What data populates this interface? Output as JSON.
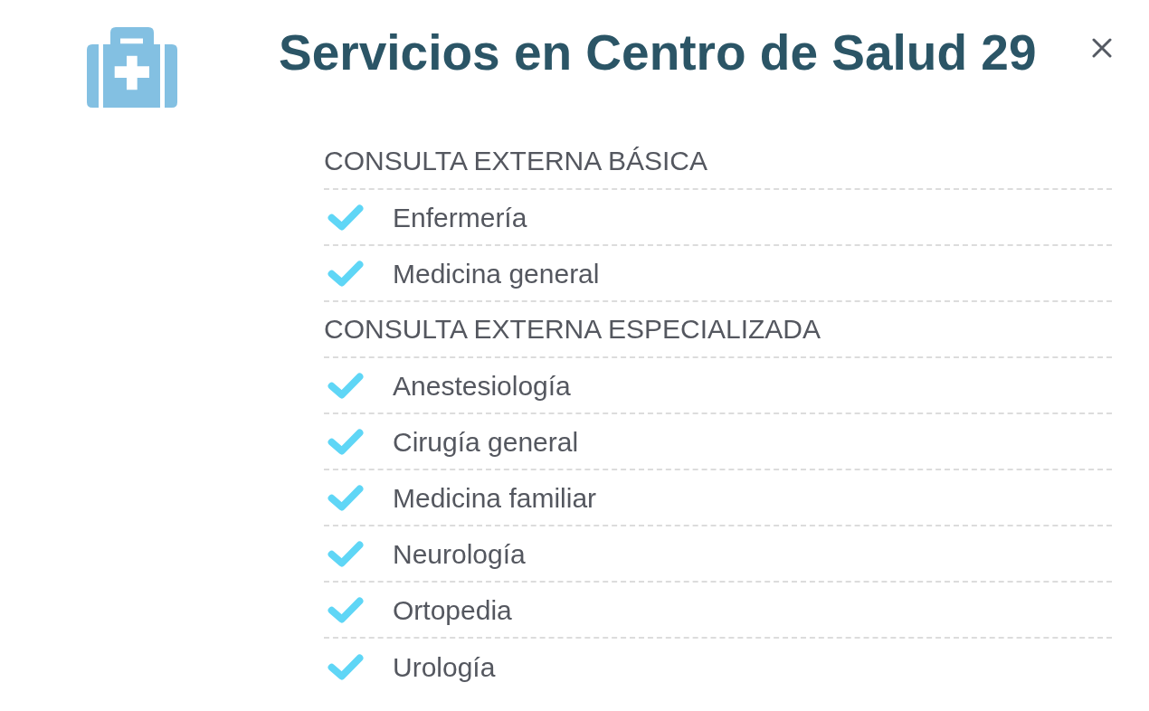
{
  "header": {
    "title": "Servicios en Centro de Salud 29"
  },
  "sections": [
    {
      "heading": "CONSULTA EXTERNA BÁSICA",
      "items": [
        "Enfermería",
        "Medicina general"
      ]
    },
    {
      "heading": "CONSULTA EXTERNA ESPECIALIZADA",
      "items": [
        "Anestesiología",
        "Cirugía general",
        "Medicina familiar",
        "Neurología",
        "Ortopedia",
        "Urología"
      ]
    }
  ]
}
